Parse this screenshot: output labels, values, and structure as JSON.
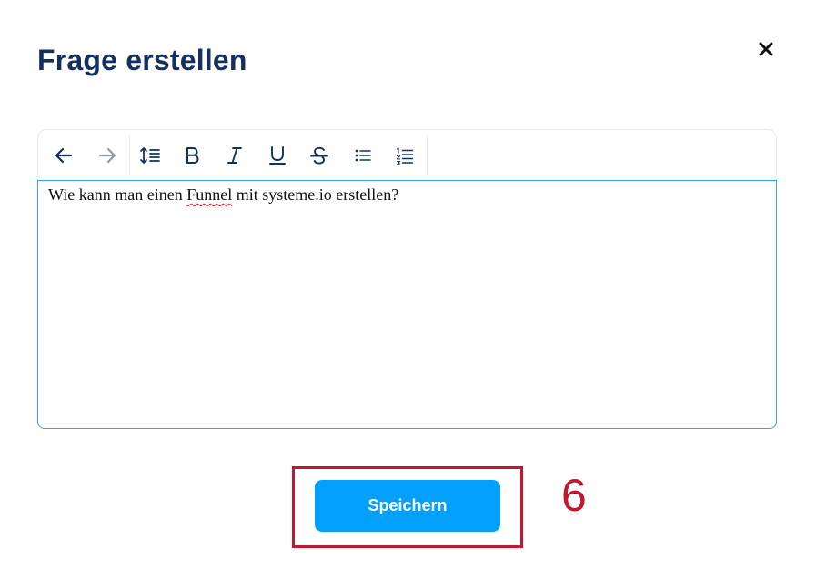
{
  "modal": {
    "title": "Frage erstellen",
    "close_icon": "close-icon"
  },
  "toolbar": {
    "buttons": [
      {
        "name": "undo",
        "icon": "arrow-left-icon",
        "enabled": true
      },
      {
        "name": "redo",
        "icon": "arrow-right-icon",
        "enabled": false
      },
      {
        "name": "line-height",
        "icon": "line-height-icon"
      },
      {
        "name": "bold",
        "icon": "bold-icon"
      },
      {
        "name": "italic",
        "icon": "italic-icon"
      },
      {
        "name": "underline",
        "icon": "underline-icon"
      },
      {
        "name": "strikethrough",
        "icon": "strikethrough-icon"
      },
      {
        "name": "bullet-list",
        "icon": "bullet-list-icon"
      },
      {
        "name": "numbered-list",
        "icon": "numbered-list-icon"
      }
    ]
  },
  "editor": {
    "text_before": "Wie kann man einen ",
    "text_misspelled": "Funnel",
    "text_after": " mit systeme.io erstellen?"
  },
  "actions": {
    "save_label": "Speichern"
  },
  "annotation": {
    "step_number": "6"
  },
  "colors": {
    "title": "#14305e",
    "icon": "#14305e",
    "icon_disabled": "#8e9aab",
    "primary_button": "#03a0fb",
    "editor_focus_border": "#2ea7ec",
    "annotation": "#c2182f"
  }
}
